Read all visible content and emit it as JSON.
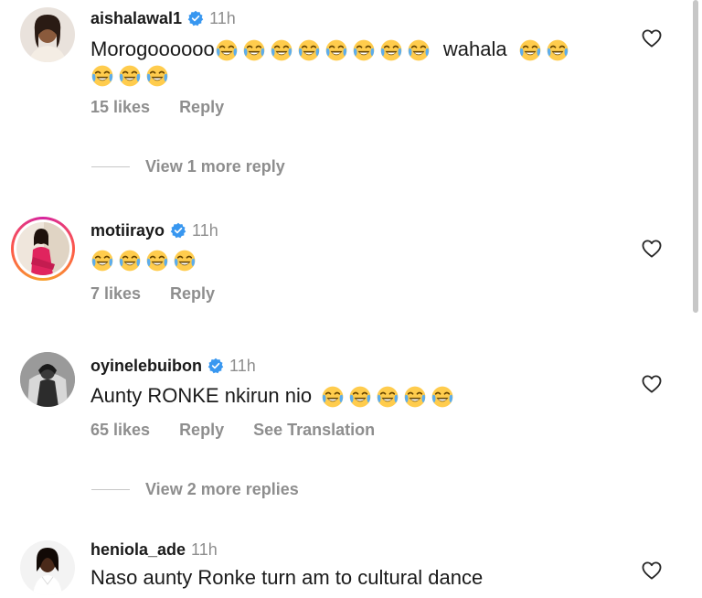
{
  "comments": [
    {
      "username": "aishalawal1",
      "verified": true,
      "time": "11h",
      "text": "Morogoooooo",
      "text_mid": "wahala",
      "likes": "15 likes",
      "reply": "Reply"
    },
    {
      "username": "motiirayo",
      "verified": true,
      "time": "11h",
      "likes": "7 likes",
      "reply": "Reply"
    },
    {
      "username": "oyinelebuibon",
      "verified": true,
      "time": "11h",
      "text": "Aunty RONKE nkirun nio",
      "likes": "65 likes",
      "reply": "Reply",
      "translate": "See Translation"
    },
    {
      "username": "heniola_ade",
      "verified": false,
      "time": "11h",
      "text": "Naso aunty Ronke turn am to cultural dance"
    }
  ],
  "view_more": [
    "View 1 more reply",
    "View 2 more replies"
  ],
  "icons": {
    "verified": "verified-badge-icon",
    "heart": "heart-outline-icon",
    "emoji": "face-with-tears-of-joy-emoji"
  },
  "colors": {
    "verified_blue": "#3897f0",
    "meta_gray": "#8e8e8e",
    "ring_gradient": "#d6249f"
  }
}
